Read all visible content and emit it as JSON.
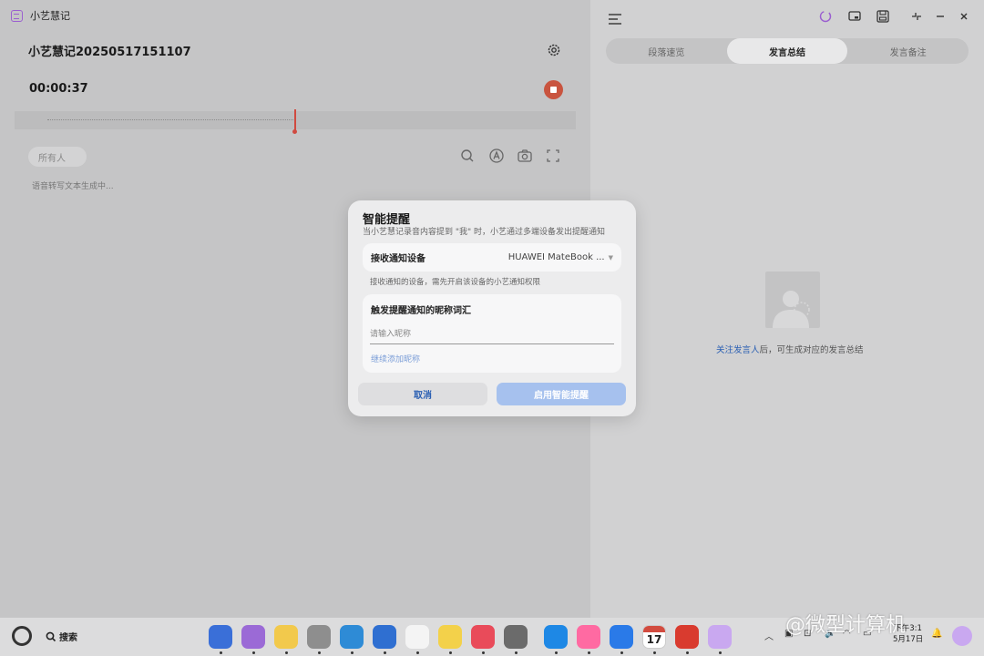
{
  "app": {
    "name": "小艺慧记",
    "recording_title": "小艺慧记20250517151107",
    "timer": "00:00:37",
    "speaker_filter": "所有人",
    "status_text": "语音转写文本生成中..."
  },
  "right_panel": {
    "tabs": [
      {
        "label": "段落速览",
        "active": false
      },
      {
        "label": "发言总结",
        "active": true
      },
      {
        "label": "发言备注",
        "active": false
      }
    ],
    "hint_link": "关注发言人",
    "hint_text": "后，可生成对应的发言总结"
  },
  "dialog": {
    "title": "智能提醒",
    "subtitle": "当小艺慧记录音内容提到 \"我\" 时，小艺通过多端设备发出提醒通知",
    "device_label": "接收通知设备",
    "device_value": "HUAWEI MateBook ...",
    "device_note": "接收通知的设备，需先开启该设备的小艺通知权限",
    "nickname_title": "触发提醒通知的昵称词汇",
    "nickname_placeholder": "请输入昵称",
    "add_nickname": "继续添加昵称",
    "cancel_label": "取消",
    "enable_label": "启用智能提醒"
  },
  "taskbar": {
    "search_label": "搜索",
    "calendar_day": "17",
    "clock_time": "下午3:1",
    "clock_date": "5月17日",
    "dock_colors": [
      "#3a6fd8",
      "#9b6ad6",
      "#f2c94c",
      "#8e8e8e",
      "#2e8bd6",
      "#2f6fd1",
      "#f4f4f4",
      "#f3d14a",
      "#e94b5a",
      "#6b6b6b",
      "#1e88e5",
      "#ff6aa2",
      "#2a7ae8",
      "#ffffff",
      "#d93b2f",
      "#c9a8f0"
    ]
  },
  "watermark": "@微型计算机"
}
